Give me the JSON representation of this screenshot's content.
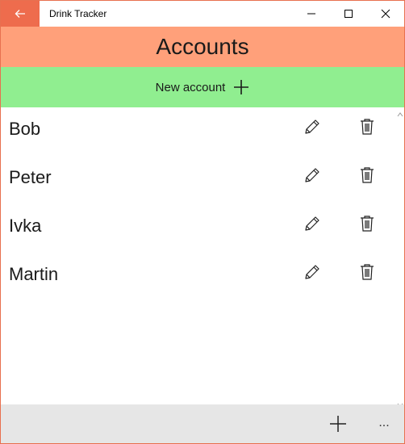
{
  "window": {
    "title": "Drink Tracker",
    "controls": [
      "minimize-icon",
      "maximize-icon",
      "close-icon"
    ]
  },
  "header": {
    "title": "Accounts",
    "color": "#ffa07a"
  },
  "new_account": {
    "label": "New account",
    "icon": "plus-icon",
    "color": "#90ee90"
  },
  "accounts": [
    {
      "name": "Bob"
    },
    {
      "name": "Peter"
    },
    {
      "name": "Ivka"
    },
    {
      "name": "Martin"
    }
  ],
  "row_actions": {
    "edit_icon": "pencil-icon",
    "delete_icon": "trash-icon"
  },
  "commandbar": {
    "add_icon": "plus-icon",
    "more_label": "..."
  },
  "colors": {
    "accent": "#ee6c4d",
    "commandbar": "#e6e6e6"
  }
}
